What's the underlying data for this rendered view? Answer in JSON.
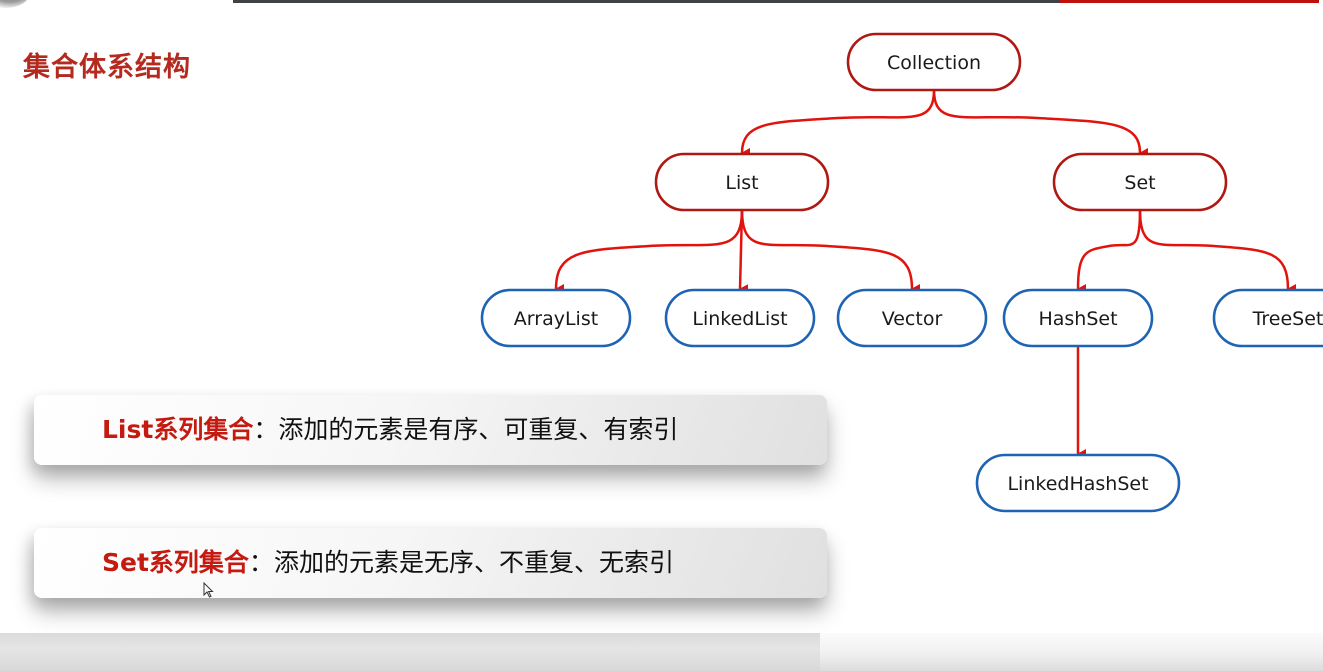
{
  "slide": {
    "title": "集合体系结构",
    "colors": {
      "title": "#b52a1f",
      "interface_border": "#b01812",
      "class_border": "#1f64b4",
      "arrow": "#e0140c",
      "accent_text": "#c41a10",
      "top_bar_dark": "#3f4244",
      "top_bar_red": "#c0100e"
    }
  },
  "diagram": {
    "nodes": [
      {
        "id": "collection",
        "label": "Collection",
        "kind": "interface"
      },
      {
        "id": "list",
        "label": "List",
        "kind": "interface"
      },
      {
        "id": "set",
        "label": "Set",
        "kind": "interface"
      },
      {
        "id": "arraylist",
        "label": "ArrayList",
        "kind": "class"
      },
      {
        "id": "linkedlist",
        "label": "LinkedList",
        "kind": "class"
      },
      {
        "id": "vector",
        "label": "Vector",
        "kind": "class"
      },
      {
        "id": "hashset",
        "label": "HashSet",
        "kind": "class"
      },
      {
        "id": "treeset",
        "label": "TreeSet",
        "kind": "class"
      },
      {
        "id": "linkedhashset",
        "label": "LinkedHashSet",
        "kind": "class"
      }
    ],
    "edges": [
      {
        "from": "collection",
        "to": "list"
      },
      {
        "from": "collection",
        "to": "set"
      },
      {
        "from": "list",
        "to": "arraylist"
      },
      {
        "from": "list",
        "to": "linkedlist"
      },
      {
        "from": "list",
        "to": "vector"
      },
      {
        "from": "set",
        "to": "hashset"
      },
      {
        "from": "set",
        "to": "treeset"
      },
      {
        "from": "hashset",
        "to": "linkedhashset"
      }
    ]
  },
  "cards": {
    "list": {
      "accent": "List系列集合",
      "separator": "：",
      "description": "添加的元素是有序、可重复、有索引"
    },
    "set": {
      "accent": "Set系列集合",
      "separator": "：",
      "description": "添加的元素是无序、不重复、无索引"
    }
  }
}
